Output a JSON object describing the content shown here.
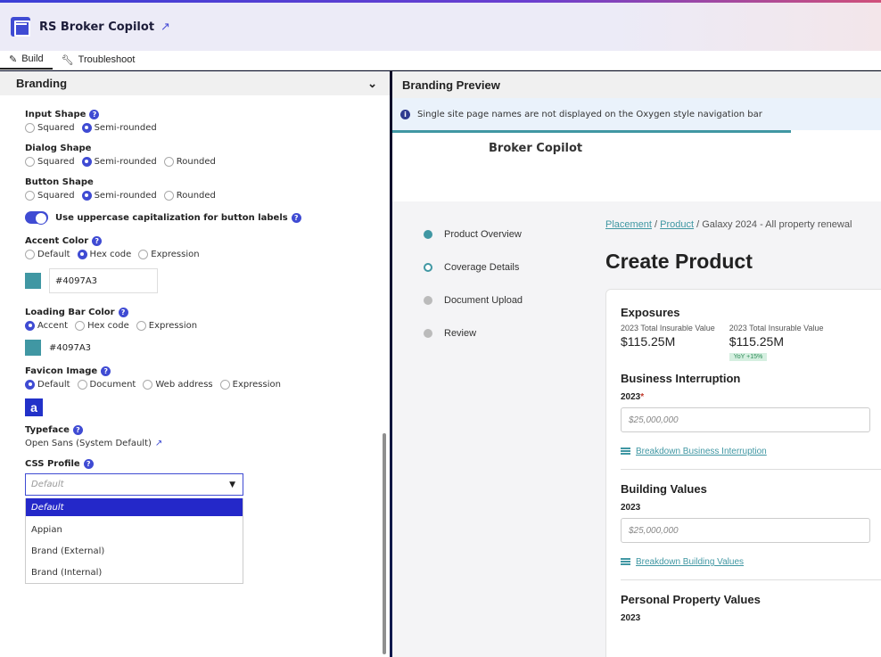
{
  "app": {
    "title": "RS Broker Copilot"
  },
  "tabs": [
    {
      "label": "Build",
      "active": true,
      "icon": "pencil-icon"
    },
    {
      "label": "Troubleshoot",
      "active": false,
      "icon": "wrench-icon"
    }
  ],
  "branding": {
    "section_title": "Branding",
    "input_shape": {
      "label": "Input Shape",
      "options": [
        "Squared",
        "Semi-rounded"
      ],
      "selected": "Semi-rounded"
    },
    "dialog_shape": {
      "label": "Dialog Shape",
      "options": [
        "Squared",
        "Semi-rounded",
        "Rounded"
      ],
      "selected": "Semi-rounded"
    },
    "button_shape": {
      "label": "Button Shape",
      "options": [
        "Squared",
        "Semi-rounded",
        "Rounded"
      ],
      "selected": "Semi-rounded"
    },
    "uppercase_toggle": {
      "label": "Use uppercase capitalization for button labels",
      "on": true
    },
    "accent_color": {
      "label": "Accent Color",
      "options": [
        "Default",
        "Hex code",
        "Expression"
      ],
      "selected": "Hex code",
      "value": "#4097A3",
      "swatch": "#4097A3"
    },
    "loading_bar_color": {
      "label": "Loading Bar Color",
      "options": [
        "Accent",
        "Hex code",
        "Expression"
      ],
      "selected": "Accent",
      "value": "#4097A3",
      "swatch": "#4097A3"
    },
    "favicon": {
      "label": "Favicon Image",
      "options": [
        "Default",
        "Document",
        "Web address",
        "Expression"
      ],
      "selected": "Default",
      "glyph": "a"
    },
    "typeface": {
      "label": "Typeface",
      "value": "Open Sans (System Default)"
    },
    "css_profile": {
      "label": "CSS Profile",
      "placeholder": "Default",
      "options": [
        "Default",
        "Appian",
        "Brand (External)",
        "Brand (Internal)"
      ],
      "highlighted": "Default"
    }
  },
  "preview": {
    "title": "Branding Preview",
    "info": "Single site page names are not displayed on the Oxygen style navigation bar",
    "site_name": "Broker Copilot",
    "steps": [
      {
        "label": "Product Overview",
        "state": "done"
      },
      {
        "label": "Coverage Details",
        "state": "current"
      },
      {
        "label": "Document Upload",
        "state": "todo"
      },
      {
        "label": "Review",
        "state": "todo"
      }
    ],
    "breadcrumb": {
      "link1": "Placement",
      "sep": " / ",
      "link2": "Product",
      "rest": " / Galaxy 2024 - All property renewal"
    },
    "page_title": "Create Product",
    "card": {
      "exposures_title": "Exposures",
      "exp1_label": "2023 Total Insurable Value",
      "exp1_value": "$115.25M",
      "exp2_label": "2023 Total Insurable Value",
      "exp2_value": "$115.25M",
      "yoy": "YoY +15%",
      "bi_title": "Business Interruption",
      "bi_year": "2023",
      "bi_required": "*",
      "bi_placeholder": "$25,000,000",
      "bi_link": "Breakdown Business Interruption",
      "bv_title": "Building Values",
      "bv_year": "2023",
      "bv_placeholder": "$25,000,000",
      "bv_link": "Breakdown Building Values",
      "pp_title": "Personal Property Values",
      "pp_year": "2023"
    }
  },
  "colors": {
    "accent": "#4097A3",
    "brand": "#3f4bd3"
  }
}
